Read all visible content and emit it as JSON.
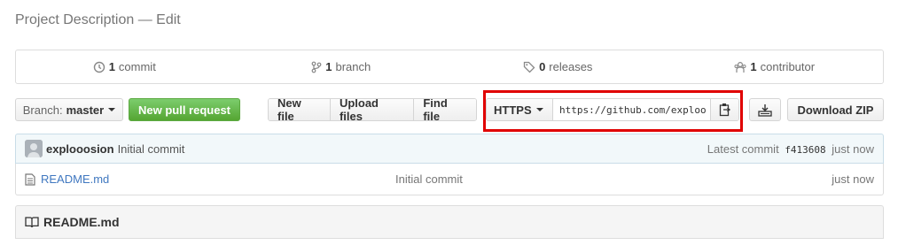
{
  "page": {
    "description": "Project Description — Edit"
  },
  "summary": {
    "commits": {
      "count": "1",
      "label": "commit",
      "icon": "history-icon"
    },
    "branches": {
      "count": "1",
      "label": "branch",
      "icon": "branch-icon"
    },
    "releases": {
      "count": "0",
      "label": "releases",
      "icon": "tag-icon"
    },
    "contributors": {
      "count": "1",
      "label": "contributor",
      "icon": "organization-icon"
    }
  },
  "toolbar": {
    "branch_prefix": "Branch:",
    "branch_name": "master",
    "new_pull_request": "New pull request",
    "new_file": "New file",
    "upload_files": "Upload files",
    "find_file": "Find file",
    "protocol": "HTTPS",
    "clone_url": "https://github.com/exploo",
    "download_zip": "Download ZIP"
  },
  "latest_commit": {
    "author": "explooosion",
    "message": "Initial commit",
    "prefix": "Latest commit",
    "sha": "f413608",
    "age": "just now"
  },
  "files": [
    {
      "name": "README.md",
      "message": "Initial commit",
      "age": "just now"
    }
  ],
  "readme": {
    "title": "README.md"
  },
  "colors": {
    "accent_green": "#55a532",
    "link_blue": "#4078c0",
    "highlight_red": "#e00000"
  }
}
